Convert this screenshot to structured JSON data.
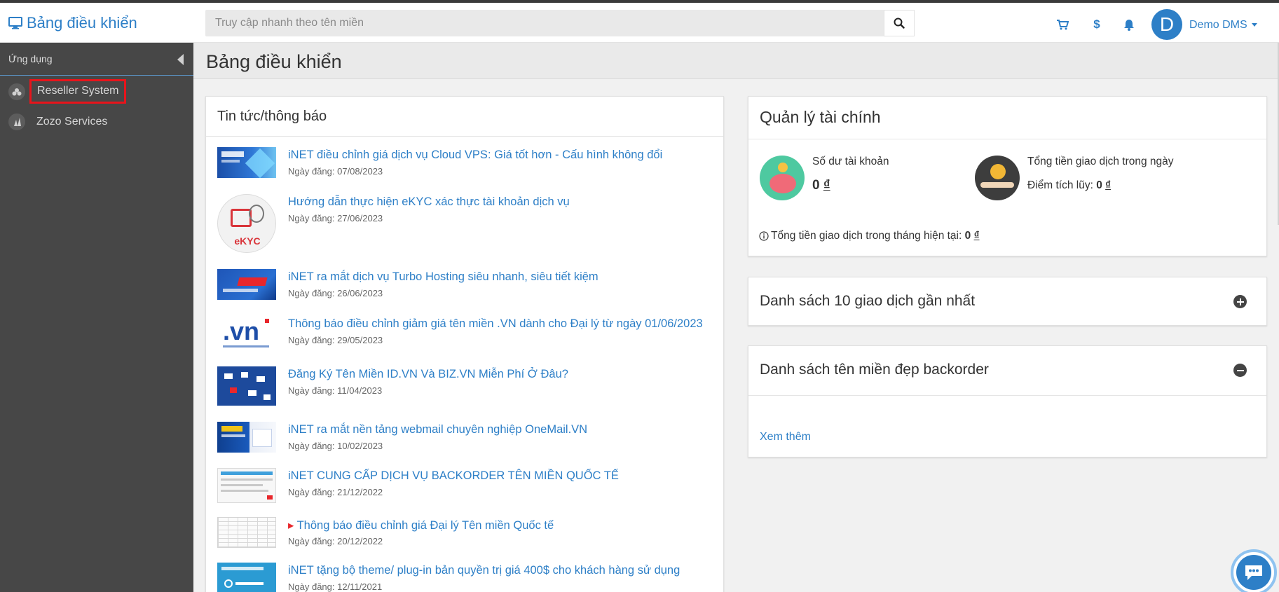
{
  "header": {
    "brand": "Bảng điều khiển",
    "search_placeholder": "Truy cập nhanh theo tên miền",
    "avatar_letter": "D",
    "user_name": "Demo DMS",
    "dollar_symbol": "$"
  },
  "sidebar": {
    "section_label": "Ứng dụng",
    "items": [
      {
        "label": "Reseller System"
      },
      {
        "label": "Zozo Services"
      }
    ]
  },
  "page": {
    "title": "Bảng điều khiển"
  },
  "news": {
    "title": "Tin tức/thông báo",
    "items": [
      {
        "title": "iNET điều chỉnh giá dịch vụ Cloud VPS: Giá tốt hơn - Cấu hình không đổi",
        "date": "Ngày đăng: 07/08/2023"
      },
      {
        "title": "Hướng dẫn thực hiện eKYC xác thực tài khoản dịch vụ",
        "date": "Ngày đăng: 27/06/2023",
        "thumb_text": "eKYC"
      },
      {
        "title": "iNET ra mắt dịch vụ Turbo Hosting siêu nhanh, siêu tiết kiệm",
        "date": "Ngày đăng: 26/06/2023"
      },
      {
        "title": "Thông báo điều chỉnh giảm giá tên miền .VN dành cho Đại lý từ ngày 01/06/2023",
        "date": "Ngày đăng: 29/05/2023",
        "thumb_text": ".vn"
      },
      {
        "title": "Đăng Ký Tên Miền ID.VN Và BIZ.VN Miễn Phí Ở Đâu?",
        "date": "Ngày đăng: 11/04/2023"
      },
      {
        "title": "iNET ra mắt nền tảng webmail chuyên nghiệp OneMail.VN",
        "date": "Ngày đăng: 10/02/2023"
      },
      {
        "title": "iNET CUNG CẤP DỊCH VỤ BACKORDER TÊN MIỀN QUỐC TẾ",
        "date": "Ngày đăng: 21/12/2022"
      },
      {
        "title": "Thông báo điều chỉnh giá Đại lý Tên miền Quốc tế",
        "date": "Ngày đăng: 20/12/2022"
      },
      {
        "title": "iNET tặng bộ theme/ plug-in bản quyền trị giá 400$ cho khách hàng sử dụng",
        "date": "Ngày đăng: 12/11/2021"
      }
    ]
  },
  "finance": {
    "title": "Quản lý tài chính",
    "balance_label": "Số dư tài khoản",
    "balance_value": "0",
    "currency": "₫",
    "daily_label": "Tổng tiền giao dịch trong ngày",
    "points_label": "Điểm tích lũy:",
    "points_value": "0",
    "month_label": "Tổng tiền giao dịch trong tháng hiện tại:",
    "month_value": "0"
  },
  "transactions": {
    "title": "Danh sách 10 giao dịch gần nhất"
  },
  "backorder": {
    "title": "Danh sách tên miền đẹp backorder",
    "more_link": "Xem thêm"
  },
  "colors": {
    "primary": "#2d7fc7",
    "sidebar_bg": "#474747",
    "highlight_border": "#e8141b"
  }
}
